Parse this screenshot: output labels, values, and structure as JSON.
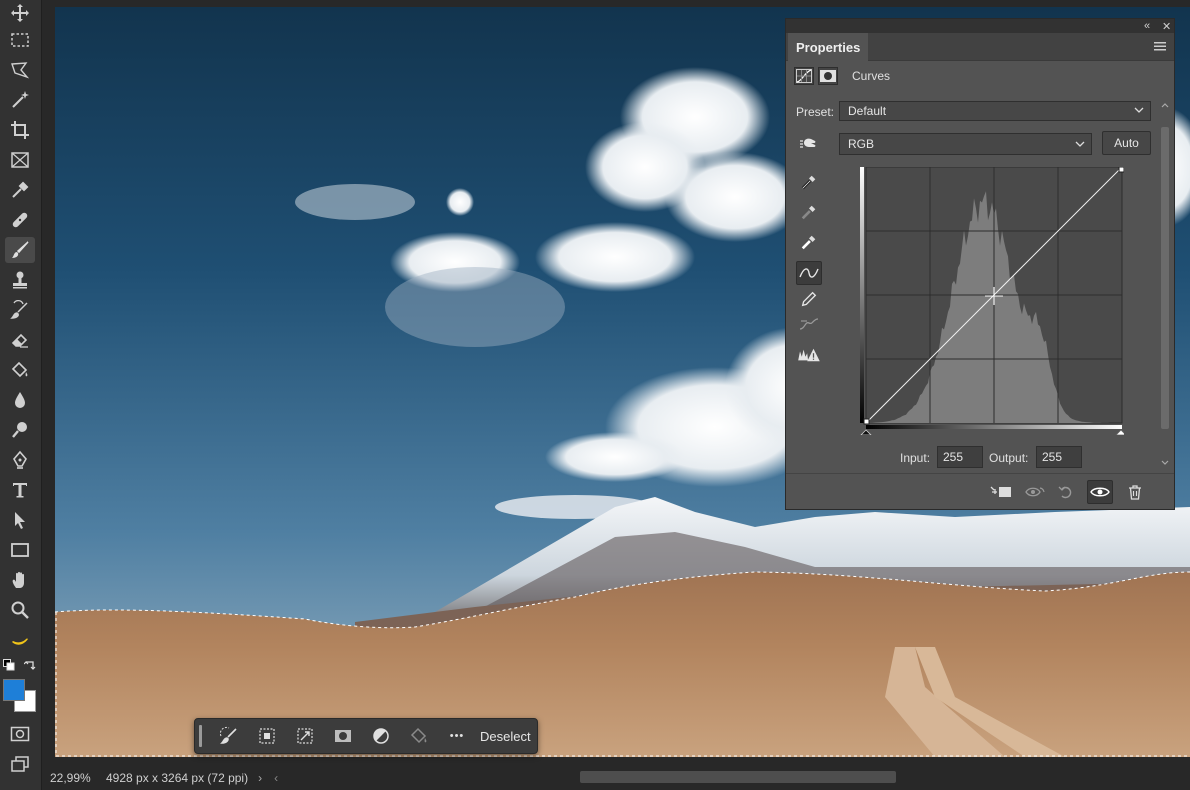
{
  "colors": {
    "foreground": "#1e7fd8",
    "background": "#ffffff",
    "panel": "#535353",
    "toolbar": "#323232"
  },
  "toolbar": {
    "tools": [
      {
        "name": "move-tool",
        "icon": "move-icon"
      },
      {
        "name": "rectangular-marquee-tool",
        "icon": "marquee-icon"
      },
      {
        "name": "polygonal-lasso-tool",
        "icon": "lasso-icon"
      },
      {
        "name": "magic-wand-tool",
        "icon": "magic-wand-icon"
      },
      {
        "name": "crop-tool",
        "icon": "crop-icon"
      },
      {
        "name": "frame-tool",
        "icon": "frame-icon"
      },
      {
        "name": "eyedropper-tool",
        "icon": "eyedropper-icon"
      },
      {
        "name": "healing-brush-tool",
        "icon": "bandage-icon"
      },
      {
        "name": "brush-tool",
        "icon": "brush-icon",
        "active": true
      },
      {
        "name": "clone-stamp-tool",
        "icon": "stamp-icon"
      },
      {
        "name": "history-brush-tool",
        "icon": "history-brush-icon"
      },
      {
        "name": "eraser-tool",
        "icon": "eraser-icon"
      },
      {
        "name": "paint-bucket-tool",
        "icon": "bucket-icon"
      },
      {
        "name": "blur-tool",
        "icon": "drop-icon"
      },
      {
        "name": "dodge-tool",
        "icon": "dodge-icon"
      },
      {
        "name": "pen-tool",
        "icon": "pen-icon"
      },
      {
        "name": "type-tool",
        "icon": "type-icon"
      },
      {
        "name": "path-selection-tool",
        "icon": "arrow-icon"
      },
      {
        "name": "rectangle-tool",
        "icon": "rectangle-icon"
      },
      {
        "name": "hand-tool",
        "icon": "hand-icon"
      },
      {
        "name": "zoom-tool",
        "icon": "zoom-icon"
      },
      {
        "name": "banana-tool",
        "icon": "banana-icon"
      }
    ]
  },
  "status": {
    "zoom": "22,99%",
    "doc_info": "4928 px x 3264 px (72 ppi)",
    "arrow": "›"
  },
  "taskbar": {
    "deselect_label": "Deselect",
    "more_label": "•••"
  },
  "properties": {
    "title": "Properties",
    "adjustment": "Curves",
    "preset_label": "Preset:",
    "preset_value": "Default",
    "channel_value": "RGB",
    "auto_label": "Auto",
    "input_label": "Input:",
    "input_value": "255",
    "output_label": "Output:",
    "output_value": "255",
    "collapse_glyph": "«",
    "close_glyph": "✕"
  }
}
